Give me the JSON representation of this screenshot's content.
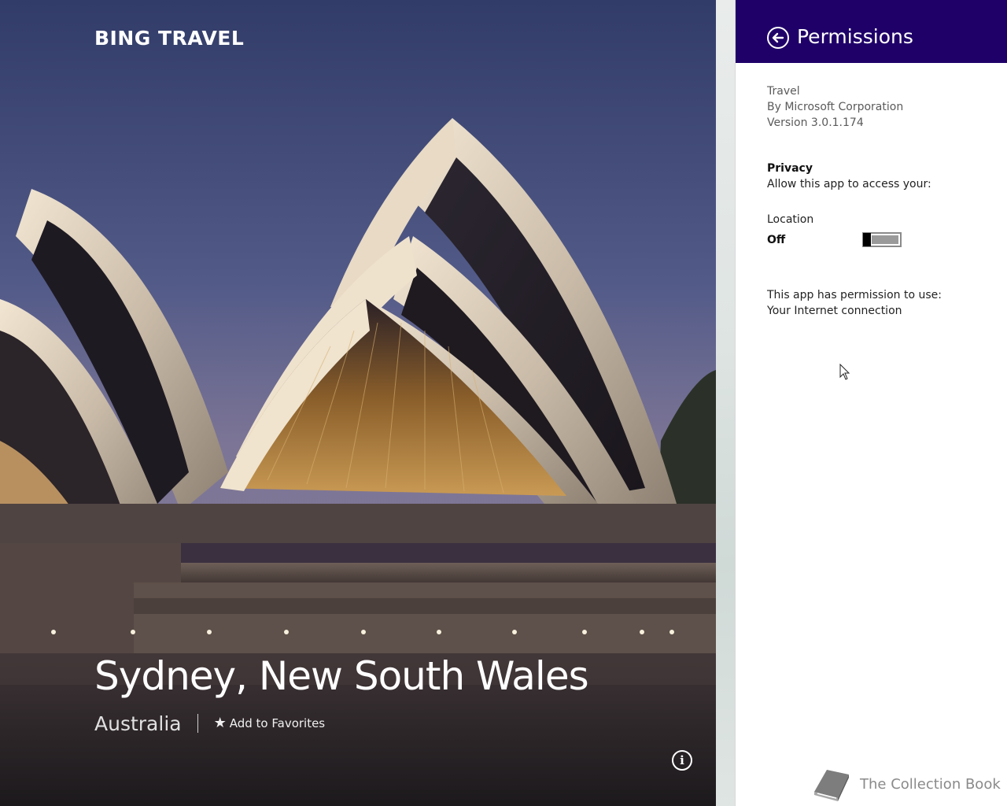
{
  "hero": {
    "brand": "BING TRAVEL",
    "city": "Sydney, New South Wales",
    "country": "Australia",
    "favorite_label": "Add to Favorites",
    "favorite_icon": "star-plus-icon",
    "info_icon": "info-icon",
    "info_glyph": "i"
  },
  "flyout": {
    "title": "Permissions",
    "back_icon": "back-arrow-icon",
    "header_color": "#1f0068",
    "app": {
      "name": "Travel",
      "publisher": "By Microsoft Corporation",
      "version": "Version 3.0.1.174"
    },
    "privacy": {
      "heading": "Privacy",
      "text": "Allow this app to access your:"
    },
    "location": {
      "label": "Location",
      "state": "Off",
      "enabled": false
    },
    "permissions": {
      "heading": "This app has permission to use:",
      "items": [
        "Your Internet connection"
      ]
    }
  },
  "watermark": {
    "text": "The Collection Book",
    "icon": "book-icon"
  }
}
